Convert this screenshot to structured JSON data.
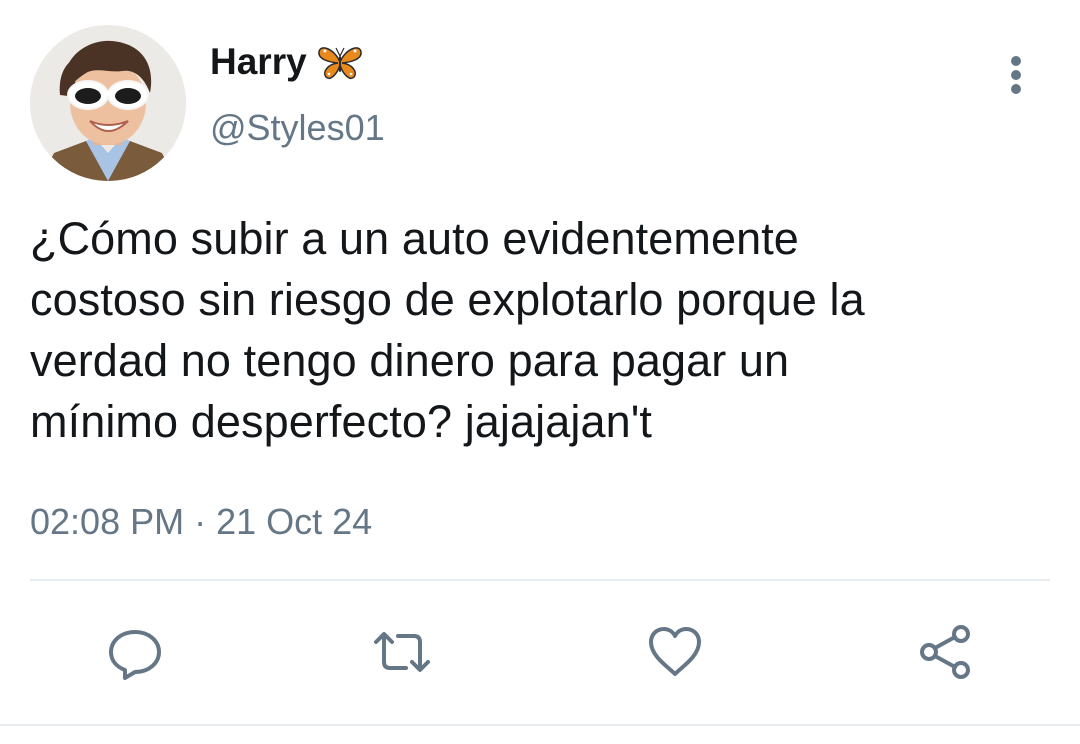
{
  "tweet": {
    "display_name": "Harry",
    "name_emoji_icon": "butterfly-icon",
    "handle": "@Styles01",
    "text_lines": [
      "¿Cómo subir a un auto evidentemente",
      "costoso sin riesgo de explotarlo porque la",
      "verdad no tengo dinero para pagar un",
      "mínimo desperfecto? jajajajan't"
    ],
    "timestamp": "02:08 PM · 21 Oct 24",
    "more_icon": "more-vertical-icon"
  },
  "actions": [
    {
      "name": "reply",
      "icon": "comment-icon"
    },
    {
      "name": "retweet",
      "icon": "retweet-icon"
    },
    {
      "name": "like",
      "icon": "heart-icon"
    },
    {
      "name": "share",
      "icon": "share-icon"
    }
  ],
  "colors": {
    "text_primary": "#14171a",
    "text_secondary": "#657786",
    "divider": "#e6ecf0",
    "butterfly": "#e8891c"
  }
}
